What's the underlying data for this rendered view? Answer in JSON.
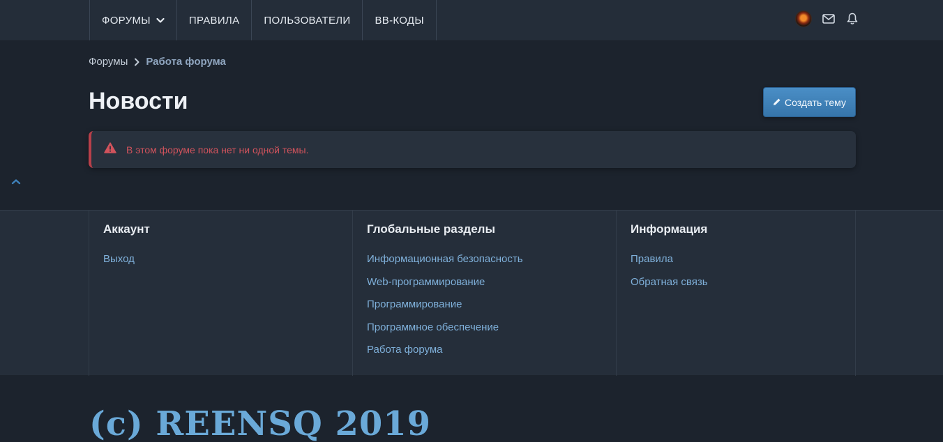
{
  "nav": {
    "items": [
      {
        "label": "ФОРУМЫ"
      },
      {
        "label": "ПРАВИЛА"
      },
      {
        "label": "ПОЛЬЗОВАТЕЛИ"
      },
      {
        "label": "BB-КОДЫ"
      }
    ],
    "icons": [
      "avatar",
      "envelope-icon",
      "bell-icon"
    ]
  },
  "breadcrumb": {
    "items": [
      "Форумы",
      "Работа форума"
    ]
  },
  "page": {
    "title": "Новости",
    "create_button": "Создать тему"
  },
  "alert": {
    "text": "В этом форуме пока нет ни одной темы."
  },
  "footer": {
    "columns": [
      {
        "title": "Аккаунт",
        "links": [
          "Выход"
        ]
      },
      {
        "title": "Глобальные разделы",
        "links": [
          "Информационная безопасность",
          "Web-программирование",
          "Программирование",
          "Программное обеспечение",
          "Работа форума"
        ]
      },
      {
        "title": "Информация",
        "links": [
          "Правила",
          "Обратная связь"
        ]
      }
    ],
    "copyright": "(c) REENSQ 2019"
  },
  "colors": {
    "background": "#1c232d",
    "topbar": "#242d39",
    "accent": "#3f82bb",
    "link": "#7fb0da",
    "error": "#d1535c"
  }
}
